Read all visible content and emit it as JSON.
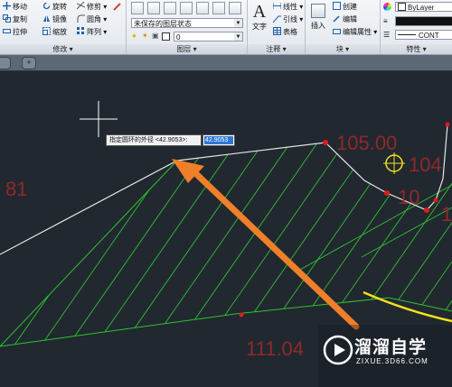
{
  "ribbon": {
    "modify": {
      "title": "修改",
      "move": "移动",
      "rotate": "旋转",
      "trim": "修剪",
      "copy": "复制",
      "mirror": "镜像",
      "fillet": "圆角",
      "stretch": "拉伸",
      "scale": "缩放",
      "array": "阵列"
    },
    "layers": {
      "title": "图层",
      "state_combo": "未保存的图层状态",
      "layer_combo": "0"
    },
    "annotation": {
      "title": "注释",
      "text": "文字",
      "linear": "线性",
      "leader": "引线",
      "table": "表格"
    },
    "block": {
      "title": "块",
      "insert": "插入",
      "create": "创建",
      "edit": "编辑",
      "edit_attributes": "编辑属性"
    },
    "properties": {
      "title": "特性",
      "color": "ByLayer",
      "linetype": "ByLayer",
      "lineweight": "CONT"
    }
  },
  "drawing": {
    "labels": {
      "elev_top": "105.00",
      "elev_right1": "104",
      "elev_right2": "10",
      "elev_right3": "1",
      "elev_left": "81",
      "elev_bottom": "111.04"
    }
  },
  "tooltip": {
    "prompt": "指定圆环的外径 <42.9053>:",
    "value": "42.9053"
  },
  "watermark": {
    "title": "溜溜自学",
    "subtitle": "ZIXUE.3D66.COM"
  },
  "colors": {
    "hatch": "#2fc22f",
    "annotation_text": "#8e2a2a",
    "arrow": "#f07f2a",
    "grip": "#e01a1a",
    "polyline": "#e6e6e6",
    "highlight_line": "#f2e21c"
  }
}
